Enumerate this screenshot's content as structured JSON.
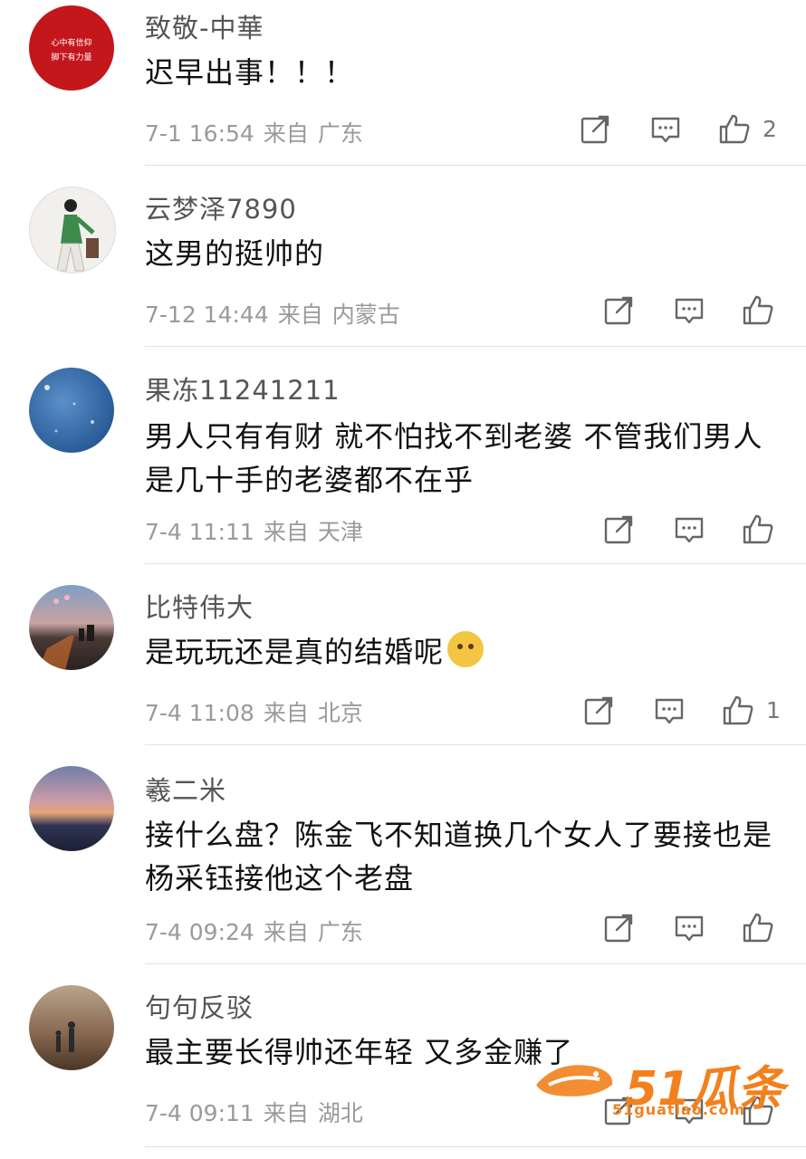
{
  "comments": [
    {
      "username": "致敬-中華",
      "content": "迟早出事！！！",
      "time": "7-1 16:54",
      "from": "来自",
      "location": "广东",
      "likes": "2",
      "avatar_text_1": "心中有信仰",
      "avatar_text_2": "脚下有力量",
      "avatar_color": "#c4171c"
    },
    {
      "username": "云梦泽7890",
      "content": "这男的挺帅的",
      "time": "7-12 14:44",
      "from": "来自",
      "location": "内蒙古",
      "likes": ""
    },
    {
      "username": "果冻11241211",
      "content": "男人只有有财 就不怕找不到老婆 不管我们男人是几十手的老婆都不在乎",
      "time": "7-4 11:11",
      "from": "来自",
      "location": "天津",
      "likes": ""
    },
    {
      "username": "比特伟大",
      "content": "是玩玩还是真的结婚呢",
      "time": "7-4 11:08",
      "from": "来自",
      "location": "北京",
      "likes": "1"
    },
    {
      "username": "羲二米",
      "content": "接什么盘？陈金飞不知道换几个女人了要接也是杨采钰接他这个老盘",
      "time": "7-4 09:24",
      "from": "来自",
      "location": "广东",
      "likes": ""
    },
    {
      "username": "句句反驳",
      "content": "最主要长得帅还年轻 又多金赚了",
      "time": "7-4 09:11",
      "from": "来自",
      "location": "湖北",
      "likes": ""
    }
  ],
  "icons": {
    "share": "share-icon",
    "reply": "comment-icon",
    "like": "thumbs-up-icon",
    "emoji": "doge-emoji-icon"
  },
  "watermark": {
    "brand": "51瓜条",
    "url": "51guatiao.com",
    "color": "#f2811d"
  }
}
